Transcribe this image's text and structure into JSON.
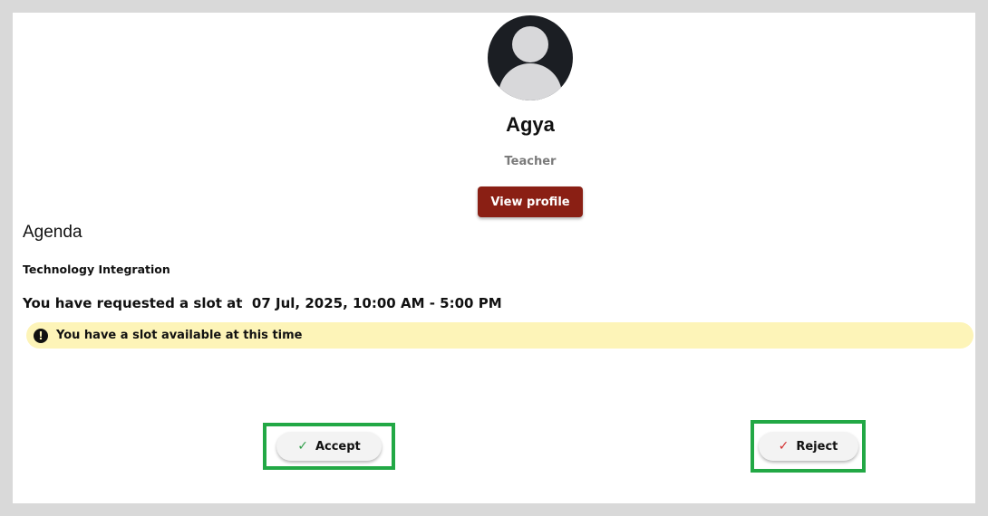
{
  "profile": {
    "name": "Agya",
    "role": "Teacher",
    "view_profile_label": "View profile"
  },
  "agenda": {
    "title": "Agenda",
    "topic": "Technology Integration",
    "request_text": "You have requested a slot at  07 Jul, 2025, 10:00 AM - 5:00 PM"
  },
  "alert": {
    "icon": "exclamation-icon",
    "symbol": "!",
    "text": "You have a slot available at this time",
    "background": "#fdf4b8"
  },
  "actions": {
    "accept": {
      "label": "Accept",
      "icon": "check-icon",
      "icon_glyph": "✓",
      "icon_color": "#2e9e48"
    },
    "reject": {
      "label": "Reject",
      "icon": "check-icon",
      "icon_glyph": "✓",
      "icon_color": "#d32f2f"
    }
  },
  "colors": {
    "primary_button": "#8a1f14",
    "highlight_frame": "#22a845",
    "avatar_background": "#1b1e23"
  }
}
